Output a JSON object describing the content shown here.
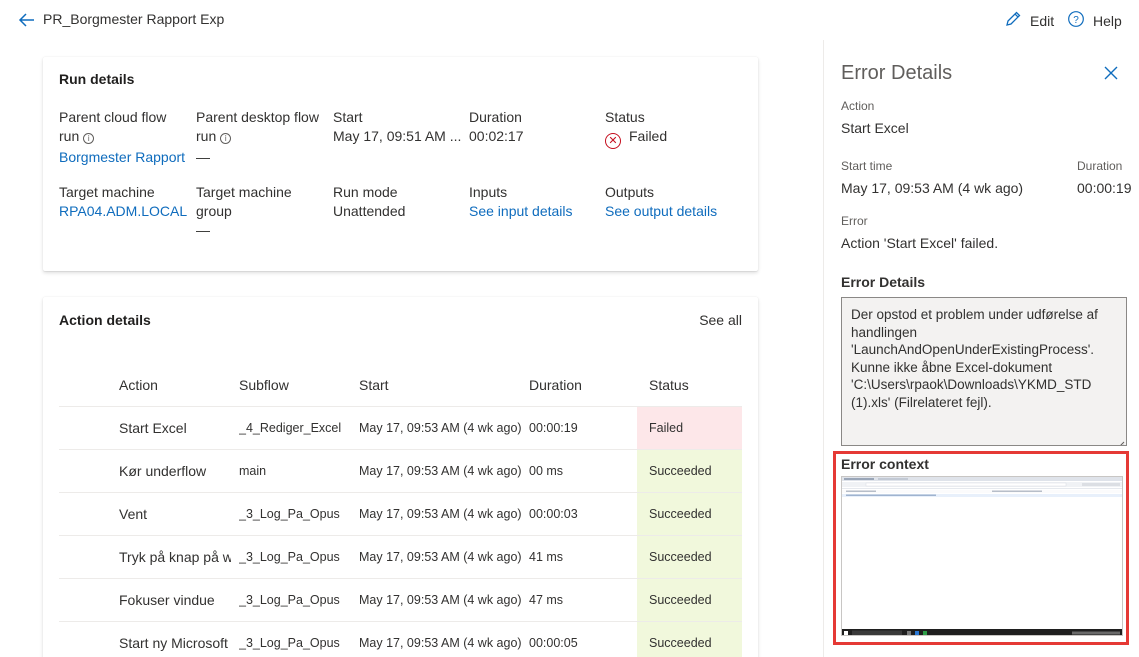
{
  "header": {
    "title": "PR_Borgmester Rapport Exp",
    "edit_label": "Edit",
    "help_label": "Help"
  },
  "run_details": {
    "title": "Run details",
    "parent_cloud_flow": {
      "label": "Parent cloud flow run",
      "value": "Borgmester Rapport"
    },
    "parent_desktop_flow": {
      "label": "Parent desktop flow run",
      "value": "—"
    },
    "start": {
      "label": "Start",
      "value": "May 17, 09:51 AM ..."
    },
    "duration": {
      "label": "Duration",
      "value": "00:02:17"
    },
    "status": {
      "label": "Status",
      "value": "Failed"
    },
    "target_machine": {
      "label": "Target machine",
      "value": "RPA04.ADM.LOCAL"
    },
    "target_machine_group": {
      "label": "Target machine group",
      "value": "—"
    },
    "run_mode": {
      "label": "Run mode",
      "value": "Unattended"
    },
    "inputs": {
      "label": "Inputs",
      "value": "See input details"
    },
    "outputs": {
      "label": "Outputs",
      "value": "See output details"
    }
  },
  "action_details": {
    "title": "Action details",
    "see_all": "See all",
    "columns": [
      "Action",
      "Subflow",
      "Start",
      "Duration",
      "Status"
    ],
    "rows": [
      {
        "action": "Start Excel",
        "subflow": "_4_Rediger_Excel",
        "start": "May 17, 09:53 AM (4 wk ago)",
        "duration": "00:00:19",
        "status": "Failed"
      },
      {
        "action": "Kør underflow",
        "subflow": "main",
        "start": "May 17, 09:53 AM (4 wk ago)",
        "duration": "00 ms",
        "status": "Succeeded"
      },
      {
        "action": "Vent",
        "subflow": "_3_Log_Pa_Opus",
        "start": "May 17, 09:53 AM (4 wk ago)",
        "duration": "00:00:03",
        "status": "Succeeded"
      },
      {
        "action": "Tryk på knap på w",
        "subflow": "_3_Log_Pa_Opus",
        "start": "May 17, 09:53 AM (4 wk ago)",
        "duration": "41 ms",
        "status": "Succeeded"
      },
      {
        "action": "Fokuser vindue",
        "subflow": "_3_Log_Pa_Opus",
        "start": "May 17, 09:53 AM (4 wk ago)",
        "duration": "47 ms",
        "status": "Succeeded"
      },
      {
        "action": "Start ny Microsoft",
        "subflow": "_3_Log_Pa_Opus",
        "start": "May 17, 09:53 AM (4 wk ago)",
        "duration": "00:00:05",
        "status": "Succeeded"
      }
    ]
  },
  "error_panel": {
    "title": "Error Details",
    "action_label": "Action",
    "action_value": "Start Excel",
    "start_label": "Start time",
    "start_value": "May 17, 09:53 AM (4 wk ago)",
    "duration_label": "Duration",
    "duration_value": "00:00:19",
    "error_label": "Error",
    "error_value": "Action 'Start Excel' failed.",
    "details_heading": "Error Details",
    "details_text": "Der opstod et problem under udførelse af handlingen 'LaunchAndOpenUnderExistingProcess'. Kunne ikke åbne Excel-dokument 'C:\\Users\\rpaok\\Downloads\\YKMD_STD (1).xls' (Filrelateret fejl).",
    "context_heading": "Error context"
  },
  "colors": {
    "link": "#0f6cbd",
    "failed_bg": "#fde7e9",
    "succeeded_bg": "#f1f8dc",
    "failed_icon": "#c50f1f",
    "highlight_border": "#e53935"
  }
}
